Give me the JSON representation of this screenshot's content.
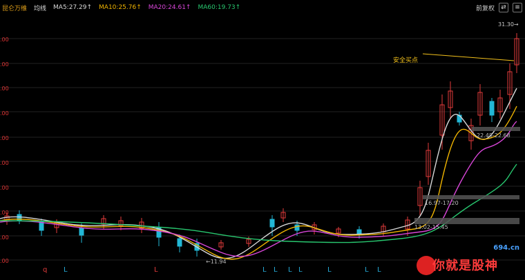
{
  "header": {
    "stock_name": "昆仑万维",
    "avg_line": "均线",
    "ma5": "MA5:27.29↑",
    "ma10": "MA10:25.76↑",
    "ma20": "MA20:24.61↑",
    "ma60": "MA60:19.73↑"
  },
  "toolbar": {
    "adjust": "前复权"
  },
  "axis": {
    "y_ticks": [
      ".00",
      ".00",
      ".00",
      ".00",
      ".00",
      ".00",
      ".00",
      ".00",
      ".00",
      ".00"
    ]
  },
  "annotations": {
    "safe_buy": "安全买点",
    "price_top": "31.30→",
    "zone1": "22.48-22.68",
    "zone2": "16.97-17.20",
    "zone3": "13.02-15.45",
    "low": "←11.94"
  },
  "bottom_markers": [
    "q",
    "L",
    "L",
    "L",
    "L",
    "L",
    "L",
    "L",
    "L",
    "L",
    "L"
  ],
  "watermark": {
    "domain": "694.cn",
    "text": "你就是股神"
  },
  "colors": {
    "red": "#e03b3b",
    "cyan": "#26a9d6",
    "ma5": "#d9d9d9",
    "ma10": "#f0b400",
    "ma20": "#d946d9",
    "ma60": "#28c76f"
  }
}
